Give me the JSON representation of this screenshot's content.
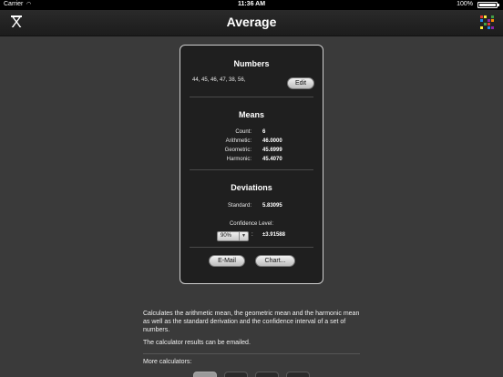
{
  "status": {
    "carrier": "Carrier",
    "time": "11:36 AM",
    "battery_pct": "100%"
  },
  "nav": {
    "title": "Average",
    "left_icon": "mean-symbol-icon",
    "right_icon": "color-grid-icon"
  },
  "numbers": {
    "title": "Numbers",
    "list": "44, 45, 46, 47, 38, 56,",
    "edit_label": "Edit"
  },
  "means": {
    "title": "Means",
    "rows": [
      {
        "label": "Count:",
        "value": "6"
      },
      {
        "label": "Arithmetic:",
        "value": "46.0000"
      },
      {
        "label": "Geometric:",
        "value": "45.6999"
      },
      {
        "label": "Harmonic:",
        "value": "45.4070"
      }
    ]
  },
  "deviations": {
    "title": "Deviations",
    "standard_label": "Standard:",
    "standard_value": "5.83095",
    "confidence_label": "Confidence Level:",
    "confidence_selected": "90%",
    "confidence_colon": ":",
    "confidence_value": "±3.91588"
  },
  "actions": {
    "email_label": "E-Mail",
    "chart_label": "Chart..."
  },
  "footer": {
    "description": "Calculates the arithmetic mean, the geometric mean and the harmonic mean as well as the standard derivation and the confidence interval of a set of numbers.",
    "note": "The calculator results can be emailed.",
    "more_label": "More calculators:"
  },
  "colors": {
    "background": "#3a3a3a",
    "card": "#1f1f1f",
    "grid_icon": [
      "#e53935",
      "#ffeb3b",
      "#43a047",
      "#1e88e5",
      "#8e24aa",
      "#fb8c00"
    ]
  }
}
